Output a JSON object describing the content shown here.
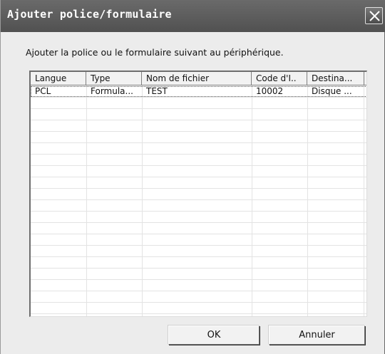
{
  "window": {
    "title": "Ajouter police/formulaire",
    "close_icon": "close-x"
  },
  "prompt": "Ajouter la police ou le formulaire suivant au périphérique.",
  "list": {
    "columns": [
      "Langue",
      "Type",
      "Nom de fichier",
      "Code d'I..",
      "Destina..."
    ],
    "rows": [
      [
        "PCL",
        "Formula...",
        "TEST",
        "10002",
        "Disque ..."
      ]
    ]
  },
  "buttons": {
    "ok": "OK",
    "cancel": "Annuler"
  }
}
